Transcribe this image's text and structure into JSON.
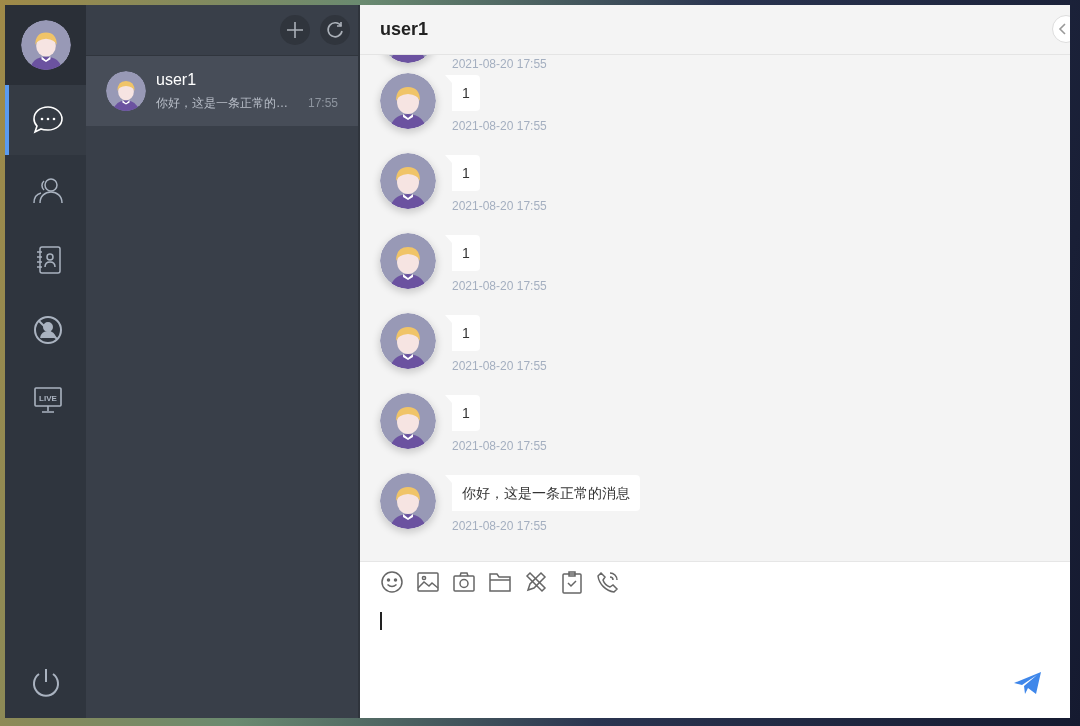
{
  "nav": {
    "items": [
      {
        "kind": "chat",
        "selected": true
      },
      {
        "kind": "friends",
        "selected": false
      },
      {
        "kind": "contacts",
        "selected": false
      },
      {
        "kind": "blocked",
        "selected": false
      },
      {
        "kind": "live",
        "selected": false,
        "label": "LIVE"
      }
    ]
  },
  "conversations": [
    {
      "name": "user1",
      "preview": "你好，这是一条正常的…",
      "time": "17:55",
      "selected": true
    }
  ],
  "chat": {
    "title": "user1",
    "messages": [
      {
        "time": "2021-08-20 17:55"
      },
      {
        "text": "1",
        "time": "2021-08-20 17:55"
      },
      {
        "text": "1",
        "time": "2021-08-20 17:55"
      },
      {
        "text": "1",
        "time": "2021-08-20 17:55"
      },
      {
        "text": "1",
        "time": "2021-08-20 17:55"
      },
      {
        "text": "1",
        "time": "2021-08-20 17:55"
      },
      {
        "text": "你好，这是一条正常的消息",
        "time": "2021-08-20 17:55"
      }
    ],
    "toolbar": [
      {
        "kind": "emoji"
      },
      {
        "kind": "image"
      },
      {
        "kind": "camera"
      },
      {
        "kind": "folder"
      },
      {
        "kind": "tools"
      },
      {
        "kind": "clipboard"
      },
      {
        "kind": "call"
      }
    ]
  }
}
